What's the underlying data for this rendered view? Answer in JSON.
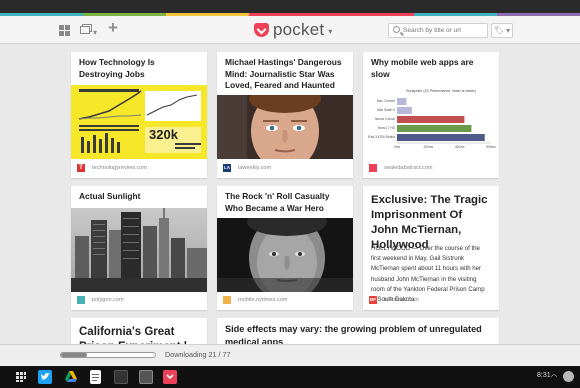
{
  "app": {
    "brand": "pocket",
    "colors": {
      "accent": "#ee4056",
      "rainbow": [
        "#3fb2bf",
        "#7cb342",
        "#f4c33a",
        "#ee4056",
        "#ee4056",
        "#3fb2bf",
        "#8c6bb1"
      ]
    }
  },
  "header": {
    "icons": [
      "grid-icon",
      "list-icon",
      "plus-icon",
      "tag-icon",
      "search-icon"
    ],
    "search": {
      "value": "",
      "placeholder": "Search by title or url"
    },
    "tag_button": "🏷 ▾"
  },
  "cards": [
    {
      "title": "How Technology Is Destroying Jobs",
      "domain": "technologyreview.com",
      "favicon": "T",
      "favicon_color": "#d33",
      "image": "infographic"
    },
    {
      "title": "Michael Hastings' Dangerous Mind: Journalistic Star Was Loved, Feared and Haunted",
      "domain": "laweekly.com",
      "favicon": "LA",
      "favicon_color": "#1b3c7a",
      "image": "portrait"
    },
    {
      "title": "Why mobile web apps are slow",
      "domain": "sealedabstract.com",
      "favicon": "",
      "favicon_color": "#ee4056",
      "image": "bar-chart"
    },
    {
      "title": "Actual Sunlight",
      "domain": "polygon.com",
      "favicon": "",
      "favicon_color": "#45b0b5",
      "image": "city"
    },
    {
      "title": "The Rock 'n' Roll Casualty Who Became a War Hero",
      "domain": "mobile.nytimes.com",
      "favicon": "",
      "favicon_color": "#f0b14d",
      "image": "portrait-dark"
    },
    {
      "title": "Exclusive: The Tragic Imprisonment Of John McTiernan, Hollywood",
      "domain": "buzzfeed.com",
      "favicon": "BF",
      "favicon_color": "#e8433c",
      "excerpt": "HOLLYWOOD — Over the course of the first weekend in May, Gail Sistrunk McTiernan spent about 11 hours with her husband John McTiernan in the visiting room of the Yankton Federal Prison Camp in South Dakota."
    },
    {
      "title": "California's Great Prison Experiment | The Nation"
    },
    {
      "title": "Side effects may vary: the growing problem of unregulated medical apps"
    }
  ],
  "infographic": {
    "stat": "320k"
  },
  "mini_chart": {
    "title": "Sunspider (JS Performance, lower is better)",
    "categories": [
      "Mac Chrome",
      "Mac Safari 6",
      "Nexus 4 stock",
      "Nexus 7 HD",
      "iPad 3 iOS6 Retina"
    ],
    "values": [
      60,
      95,
      430,
      475,
      560
    ],
    "colors": [
      "#b8b8d8",
      "#b8b8d8",
      "#c05050",
      "#6a9a4a",
      "#4e5a8a"
    ],
    "ticks": [
      "0ms",
      "200ms",
      "400ms",
      "600ms"
    ],
    "xlim": [
      0,
      600
    ]
  },
  "bottom": {
    "download_text": "Downloading 21 / 77",
    "downloaded": 21,
    "total": 77
  },
  "shelf": {
    "apps": [
      "launcher-icon",
      "twitter-icon",
      "drive-icon",
      "docs-icon",
      "dark-app-icon",
      "app-icon",
      "pocket-icon"
    ],
    "time": "8:31"
  }
}
